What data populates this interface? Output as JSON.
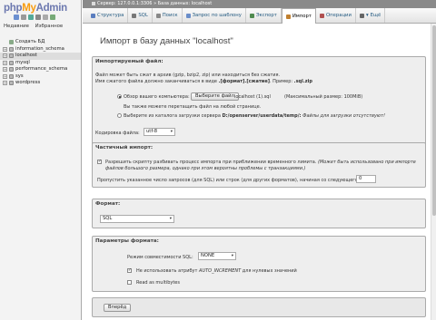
{
  "logo": {
    "php": "php",
    "my": "My",
    "admin": "Admin"
  },
  "nav": {
    "recent_label": "Недавние",
    "favorites_label": "Избранное",
    "new_db_label": "Создать БД",
    "databases": [
      {
        "label": "information_schema",
        "selected": false
      },
      {
        "label": "localhost",
        "selected": true
      },
      {
        "label": "mysql",
        "selected": false
      },
      {
        "label": "performance_schema",
        "selected": false
      },
      {
        "label": "sys",
        "selected": false
      },
      {
        "label": "wordpress",
        "selected": false
      }
    ]
  },
  "serverbar": {
    "text": "Сервер: 127.0.0.1:3306 »  База данных: localhost"
  },
  "tabs": [
    {
      "label": "Структура",
      "color": "#5a7dbf",
      "active": false
    },
    {
      "label": "SQL",
      "color": "#777777",
      "active": false
    },
    {
      "label": "Поиск",
      "color": "#888888",
      "active": false
    },
    {
      "label": "Запрос по шаблону",
      "color": "#6a8dc9",
      "active": false
    },
    {
      "label": "Экспорт",
      "color": "#4f8a4f",
      "active": false
    },
    {
      "label": "Импорт",
      "color": "#c08030",
      "active": true
    },
    {
      "label": "Операции",
      "color": "#b05050",
      "active": false
    },
    {
      "label": "Ещё",
      "color": "#666666",
      "active": false
    }
  ],
  "page": {
    "title": "Импорт в базу данных \"localhost\""
  },
  "file_section": {
    "legend": "Импортируемый файл:",
    "line1": "Файл может быть сжат в архив (gzip, bzip2, zip) или находиться без сжатия.",
    "line2_prefix": "Имя сжатого файла должно заканчиваться в виде ",
    "line2_bold": ".[формат].[сжатие]",
    "line2_suffix": ". Пример: ",
    "line2_example": ".sql.zip",
    "browse_label": "Обзор вашего компьютера:",
    "choose_file_button": "Выберите файл",
    "chosen_file": "localhost (1).sql",
    "max_size": "(Максимальный размер: 100MiB)",
    "drag_hint": "Вы также можете перетащить файл на любой странице.",
    "server_dir_label": "Выберите из каталога загрузки сервера ",
    "server_dir_path": "D:/openserver/userdata/temp/:",
    "no_files": " Файлы для загрузки отсутствуют!",
    "charset_label": "Кодировка файла:",
    "charset_value": "utf-8"
  },
  "partial_section": {
    "legend": "Частичный импорт:",
    "allow_interrupt_1": "Разрешить скрипту разбивать процесс импорта при приближении временного лимита. ",
    "allow_interrupt_it": "(Может быть использовано при импорте",
    "allow_interrupt_2": "файлов большого размера, однако при этом вероятны проблемы с транзакциями.)",
    "skip_label": "Пропустить указанное число запросов (для SQL) или строк (для других форматов), начиная со следующего:",
    "skip_value": "0"
  },
  "format_section": {
    "legend": "Формат:",
    "value": "SQL"
  },
  "options_section": {
    "legend": "Параметры формата:",
    "compat_label": "Режим совместимости SQL:",
    "compat_value": "NONE",
    "no_auto_value": "Не использовать атрибут ",
    "no_auto_value_it": "AUTO_INCREMENT",
    "no_auto_value_end": " для нулевых значений",
    "multibytes": "Read as multibytes"
  },
  "submit_label": "Вперёд"
}
